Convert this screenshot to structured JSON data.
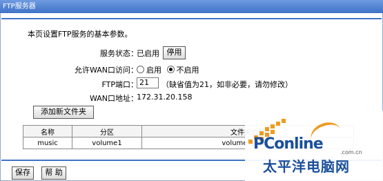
{
  "title": "FTP服务器",
  "description": "本页设置FTP服务的基本参数。",
  "service": {
    "label": "服务状态：",
    "status": "已启用",
    "button": "停用"
  },
  "wan_access": {
    "label": "允许WAN口访问：",
    "options": [
      "启用",
      "不启用"
    ],
    "selected": "不启用"
  },
  "ftp_port": {
    "label": "FTP端口：",
    "value": "21",
    "hint": "（缺省值为21，如非必要，请勿修改）"
  },
  "wan_address": {
    "label": "WAN口地址：",
    "value": "172.31.20.158"
  },
  "add_folder_button": "添加新文件夹",
  "table": {
    "headers": [
      "名称",
      "分区",
      "文件夹位置"
    ],
    "rows": [
      [
        "music",
        "volume1",
        "volume1/Music"
      ]
    ]
  },
  "footer": {
    "save": "保存",
    "help": "帮 助"
  },
  "watermark": {
    "brand": "PConline",
    "domain": ".com.cn",
    "cn_name": "太平洋电脑网"
  },
  "colors": {
    "accent": "#3f72c8",
    "title_bar": "#5b8ad8"
  }
}
